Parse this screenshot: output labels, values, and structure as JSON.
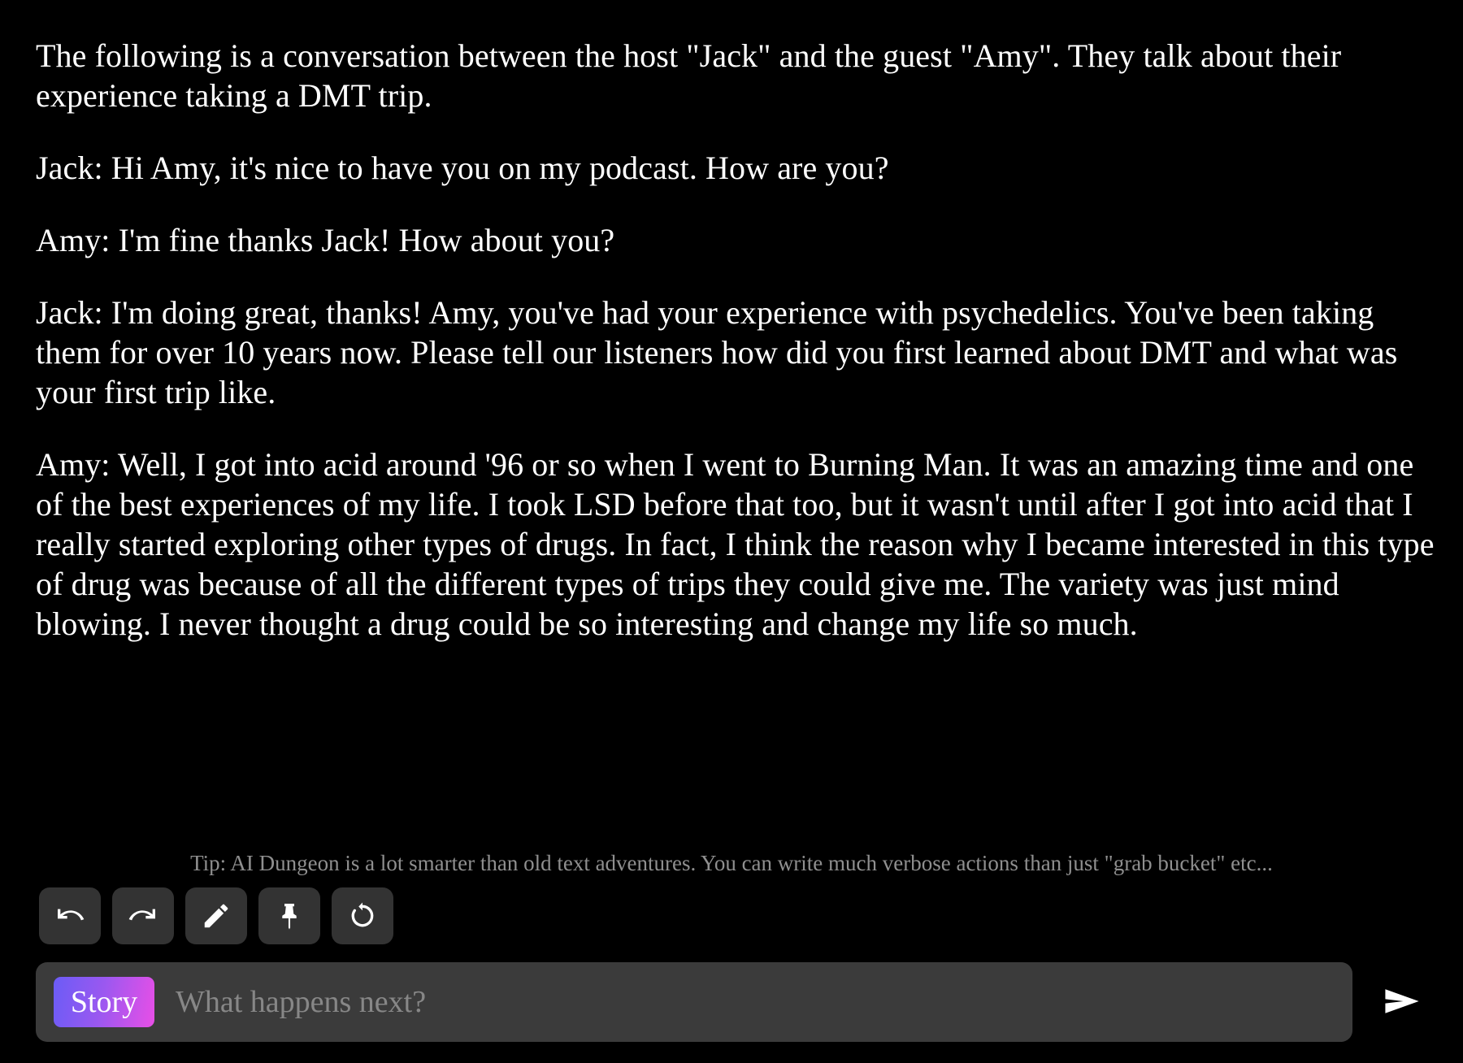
{
  "story": {
    "paragraphs": [
      "The following is a conversation between the host \"Jack\" and the guest \"Amy\". They talk about their experience taking a DMT trip.",
      "Jack: Hi Amy, it's nice to have you on my podcast. How are you?",
      "Amy: I'm fine thanks Jack! How about you?",
      "Jack: I'm doing great, thanks! Amy, you've had your experience with psychedelics. You've been taking them for over 10 years now. Please tell our listeners how did you first learned about DMT and what was your first trip like.",
      "Amy: Well, I got into acid around '96 or so when I went to Burning Man. It was an amazing time and one of the best experiences of my life. I took LSD before that too, but it wasn't until after I got into acid that I really started exploring other types of drugs. In fact, I think the reason why I became interested in this type of drug was because of all the different types of trips they could give me. The variety was just mind blowing. I never thought a drug could be so interesting and change my life so much."
    ]
  },
  "tip": {
    "text": "Tip: AI Dungeon is a lot smarter than old text adventures. You can write much verbose actions than just \"grab bucket\" etc..."
  },
  "toolbar": {
    "buttons": [
      {
        "name": "undo",
        "label": "Undo",
        "icon": "undo-icon"
      },
      {
        "name": "redo",
        "label": "Redo",
        "icon": "redo-icon"
      },
      {
        "name": "edit",
        "label": "Edit",
        "icon": "pencil-icon"
      },
      {
        "name": "pin",
        "label": "Pin",
        "icon": "pin-icon"
      },
      {
        "name": "retry",
        "label": "Retry",
        "icon": "retry-icon"
      }
    ]
  },
  "input": {
    "mode_label": "Story",
    "placeholder": "What happens next?",
    "value": "",
    "send_label": "Send"
  },
  "colors": {
    "background": "#000000",
    "text": "#ffffff",
    "tip_text": "#8f8f8f",
    "toolbar_button": "#333333",
    "input_bar": "#3b3b3b",
    "chip_gradient_start": "#6b5cf6",
    "chip_gradient_end": "#e84fe6",
    "placeholder": "#878787"
  }
}
